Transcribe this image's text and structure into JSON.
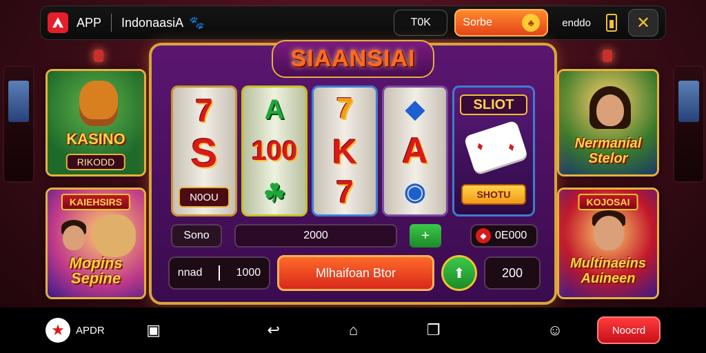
{
  "topbar": {
    "app_label": "APP",
    "region_label": "IndonaasiA",
    "tok_label": "T0K",
    "sorbe_label": "Sorbe",
    "status_text": "enddo",
    "close_symbol": "✕"
  },
  "left_cards": [
    {
      "title": "KASINO",
      "tag": "RIKODD"
    },
    {
      "banner": "KAIEHSIRS",
      "title": "Mopins Sepine"
    }
  ],
  "right_cards": [
    {
      "banner": "",
      "title": "Nermanial Stelor"
    },
    {
      "banner": "KOJOSAI",
      "title": "Multinaeins Auineen"
    }
  ],
  "machine": {
    "title": "SIAANSIAI",
    "reels": [
      {
        "top": "7",
        "mid": "S",
        "label": "N0OU"
      },
      {
        "top": "A",
        "mid": "100",
        "bot": "☘"
      },
      {
        "top": "7",
        "mid": "K",
        "bot": "7"
      },
      {
        "top": "◆",
        "mid": "A",
        "bot": "◉"
      }
    ],
    "slot_panel": {
      "title": "SLIOT",
      "button": "SHOTU"
    },
    "row1": {
      "bonus_label": "Sono",
      "credit_value": "2000",
      "plus": "+",
      "win_value": "0E000",
      "win_chip": "◆"
    },
    "row2": {
      "bet_label": "nnad",
      "bet_value": "1000",
      "spin_label": "Mlhaifoan Btor",
      "round_symbol": "⬆",
      "total_value": "200"
    }
  },
  "bottombar": {
    "app_label": "APDR",
    "button_label": "Noocrd"
  },
  "colors": {
    "accent": "#e8b23a",
    "spin": "#e4441a",
    "machine_bg": "#4a0d55"
  }
}
